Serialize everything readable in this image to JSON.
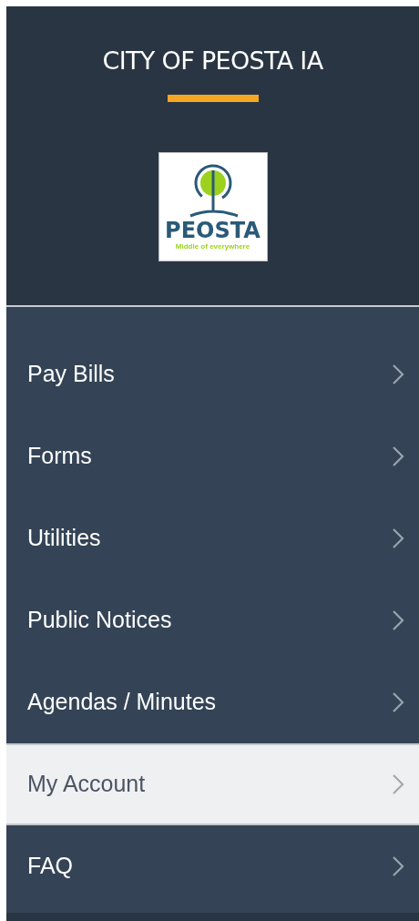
{
  "header": {
    "title": "CITY OF PEOSTA IA",
    "logo": {
      "name": "PEOSTA",
      "tagline": "Middle of everywhere"
    }
  },
  "menu": [
    {
      "label": "Pay Bills",
      "selected": false
    },
    {
      "label": "Forms",
      "selected": false
    },
    {
      "label": "Utilities",
      "selected": false
    },
    {
      "label": "Public Notices",
      "selected": false
    },
    {
      "label": "Agendas / Minutes",
      "selected": false
    },
    {
      "label": "My Account",
      "selected": true
    },
    {
      "label": "FAQ",
      "selected": false
    }
  ]
}
